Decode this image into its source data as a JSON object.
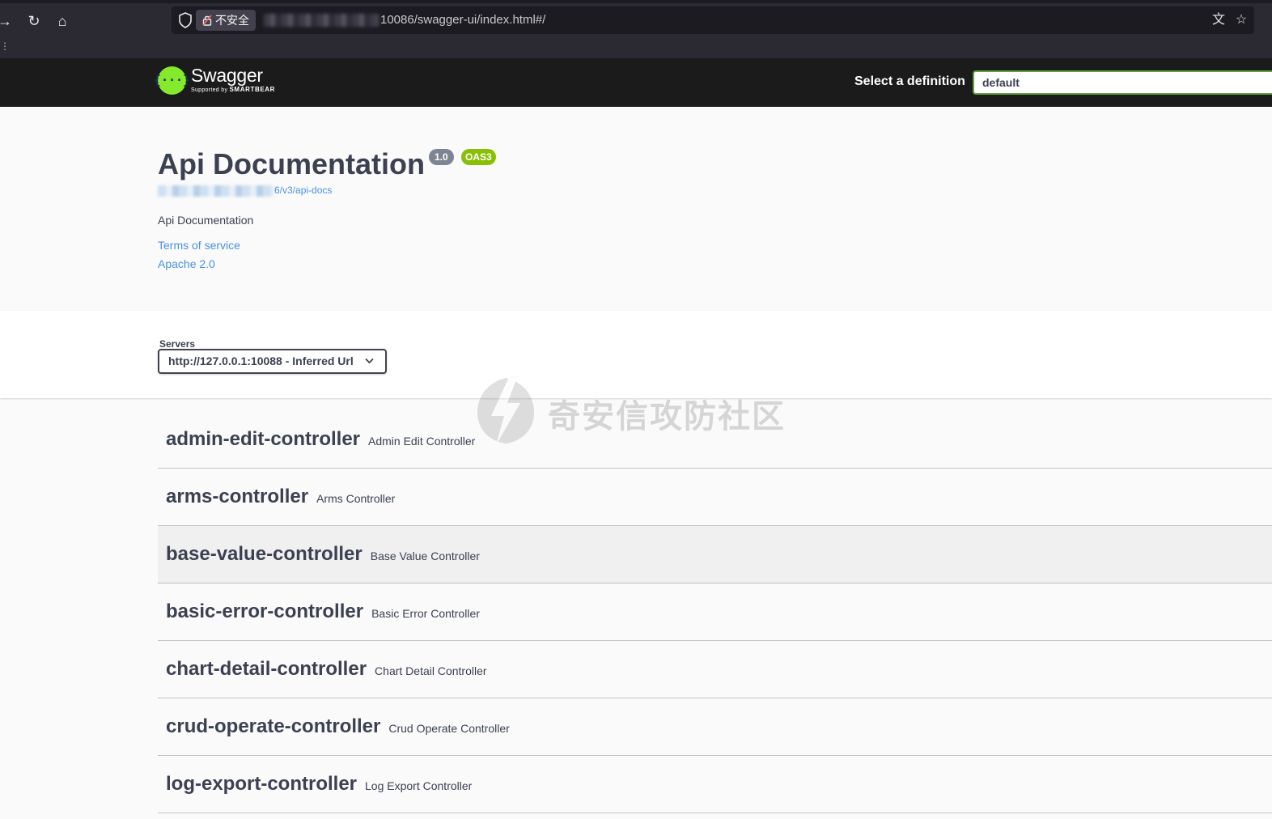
{
  "browser": {
    "security_label": "不安全",
    "url_visible": "10086/swagger-ui/index.html#/",
    "icons": [
      "forward-icon",
      "reload-icon",
      "home-icon",
      "shield-icon",
      "lock-warning-icon",
      "translate-icon",
      "bookmark-star-icon"
    ]
  },
  "topbar": {
    "logo_title": "Swagger",
    "logo_sub_prefix": "Supported by",
    "logo_sub_brand": "SMARTBEAR",
    "logo_glyph": "{···}",
    "definition_label": "Select a definition",
    "definition_value": "default"
  },
  "info": {
    "title": "Api Documentation",
    "version": "1.0",
    "oas": "OAS3",
    "doc_link_visible": "6/v3/api-docs",
    "description": "Api Documentation",
    "terms": "Terms of service",
    "license": "Apache 2.0"
  },
  "servers": {
    "label": "Servers",
    "selected": "http://127.0.0.1:10088 - Inferred Url"
  },
  "tags": [
    {
      "name": "admin-edit-controller",
      "desc": "Admin Edit Controller"
    },
    {
      "name": "arms-controller",
      "desc": "Arms Controller"
    },
    {
      "name": "base-value-controller",
      "desc": "Base Value Controller"
    },
    {
      "name": "basic-error-controller",
      "desc": "Basic Error Controller"
    },
    {
      "name": "chart-detail-controller",
      "desc": "Chart Detail Controller"
    },
    {
      "name": "crud-operate-controller",
      "desc": "Crud Operate Controller"
    },
    {
      "name": "log-export-controller",
      "desc": "Log Export Controller"
    }
  ],
  "watermark": "奇安信攻防社区",
  "colors": {
    "topbar_bg": "#1b1b1b",
    "logo_green": "#85ea2d",
    "select_border": "#62a03f",
    "badge_gray": "#7d8492",
    "badge_green": "#89bf04",
    "link_blue": "#4990e2",
    "text_dark": "#3b4151"
  }
}
